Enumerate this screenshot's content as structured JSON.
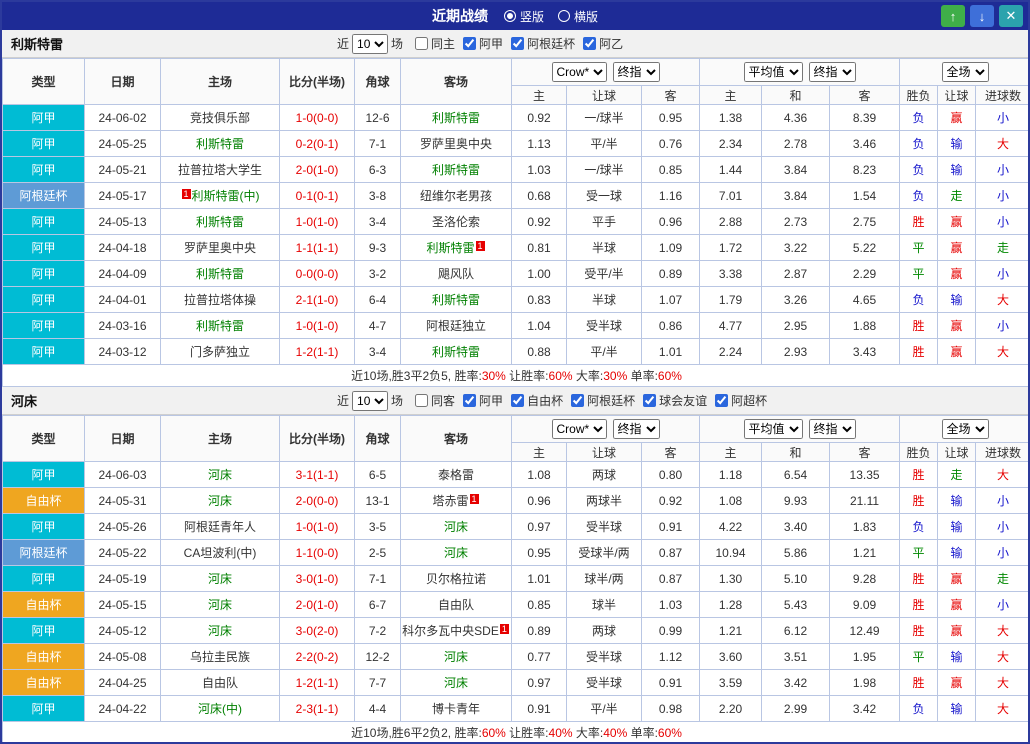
{
  "titlebar": {
    "title": "近期战绩",
    "orientation_options": [
      {
        "label": "竖版",
        "selected": true
      },
      {
        "label": "横版",
        "selected": false
      }
    ],
    "buttons": {
      "up": "↑",
      "down": "↓",
      "close": "✕"
    }
  },
  "injury_badge": "1",
  "colors": {
    "titlebar_bg": "#1e2b96",
    "type_badges": {
      "阿甲": "#00bcd4",
      "阿根廷杯": "#5e9bd6",
      "自由杯": "#efa620"
    },
    "result": {
      "胜": "#e60000",
      "赢": "#e60000",
      "大": "#e60000",
      "负": "#1414cc",
      "输": "#1414cc",
      "小": "#1414cc",
      "平": "#008800",
      "走": "#008800"
    },
    "team_highlight": "#008000",
    "score": "#e60000"
  },
  "table_headers": {
    "left_cols": [
      "类型",
      "日期",
      "主场",
      "比分(半场)",
      "角球",
      "客场"
    ],
    "groups": [
      {
        "selects": [
          "Crow*",
          "终指"
        ],
        "cols": [
          "主",
          "让球",
          "客"
        ]
      },
      {
        "selects": [
          "平均值",
          "终指"
        ],
        "cols": [
          "主",
          "和",
          "客"
        ]
      },
      {
        "selects": [
          "全场"
        ],
        "cols": [
          "胜负",
          "让球",
          "进球数"
        ]
      }
    ]
  },
  "sections": [
    {
      "team": "利斯特雷",
      "filter": {
        "near_label": "近",
        "count": "10",
        "count_suffix": "场",
        "same_option": {
          "label": "同主",
          "checked": false
        },
        "leagues": [
          {
            "label": "阿甲",
            "checked": true
          },
          {
            "label": "阿根廷杯",
            "checked": true
          },
          {
            "label": "阿乙",
            "checked": true
          }
        ]
      },
      "rows": [
        {
          "type": "阿甲",
          "date": "24-06-02",
          "home": {
            "text": "竞技俱乐部"
          },
          "score": "1-0(0-0)",
          "corner": "12-6",
          "away": {
            "text": "利斯特雷",
            "highlight": true
          },
          "odds1": [
            "0.92",
            "一/球半",
            "0.95"
          ],
          "odds2": [
            "1.38",
            "4.36",
            "8.39"
          ],
          "results": [
            "负",
            "赢",
            "小"
          ]
        },
        {
          "type": "阿甲",
          "date": "24-05-25",
          "home": {
            "text": "利斯特雷",
            "highlight": true
          },
          "score": "0-2(0-1)",
          "corner": "7-1",
          "away": {
            "text": "罗萨里奥中央"
          },
          "odds1": [
            "1.13",
            "平/半",
            "0.76"
          ],
          "odds2": [
            "2.34",
            "2.78",
            "3.46"
          ],
          "results": [
            "负",
            "输",
            "大"
          ]
        },
        {
          "type": "阿甲",
          "date": "24-05-21",
          "home": {
            "text": "拉普拉塔大学生"
          },
          "score": "2-0(1-0)",
          "corner": "6-3",
          "away": {
            "text": "利斯特雷",
            "highlight": true
          },
          "odds1": [
            "1.03",
            "一/球半",
            "0.85"
          ],
          "odds2": [
            "1.44",
            "3.84",
            "8.23"
          ],
          "results": [
            "负",
            "输",
            "小"
          ]
        },
        {
          "type": "阿根廷杯",
          "date": "24-05-17",
          "home": {
            "text": "利斯特雷(中)",
            "highlight": true,
            "badge": "before"
          },
          "score": "0-1(0-1)",
          "corner": "3-8",
          "away": {
            "text": "纽维尔老男孩"
          },
          "odds1": [
            "0.68",
            "受一球",
            "1.16"
          ],
          "odds2": [
            "7.01",
            "3.84",
            "1.54"
          ],
          "results": [
            "负",
            "走",
            "小"
          ]
        },
        {
          "type": "阿甲",
          "date": "24-05-13",
          "home": {
            "text": "利斯特雷",
            "highlight": true
          },
          "score": "1-0(1-0)",
          "corner": "3-4",
          "away": {
            "text": "圣洛伦索"
          },
          "odds1": [
            "0.92",
            "平手",
            "0.96"
          ],
          "odds2": [
            "2.88",
            "2.73",
            "2.75"
          ],
          "results": [
            "胜",
            "赢",
            "小"
          ]
        },
        {
          "type": "阿甲",
          "date": "24-04-18",
          "home": {
            "text": "罗萨里奥中央"
          },
          "score": "1-1(1-1)",
          "corner": "9-3",
          "away": {
            "text": "利斯特雷",
            "highlight": true,
            "badge": "after"
          },
          "odds1": [
            "0.81",
            "半球",
            "1.09"
          ],
          "odds2": [
            "1.72",
            "3.22",
            "5.22"
          ],
          "results": [
            "平",
            "赢",
            "走"
          ]
        },
        {
          "type": "阿甲",
          "date": "24-04-09",
          "home": {
            "text": "利斯特雷",
            "highlight": true
          },
          "score": "0-0(0-0)",
          "corner": "3-2",
          "away": {
            "text": "飓风队"
          },
          "odds1": [
            "1.00",
            "受平/半",
            "0.89"
          ],
          "odds2": [
            "3.38",
            "2.87",
            "2.29"
          ],
          "results": [
            "平",
            "赢",
            "小"
          ]
        },
        {
          "type": "阿甲",
          "date": "24-04-01",
          "home": {
            "text": "拉普拉塔体操"
          },
          "score": "2-1(1-0)",
          "corner": "6-4",
          "away": {
            "text": "利斯特雷",
            "highlight": true
          },
          "odds1": [
            "0.83",
            "半球",
            "1.07"
          ],
          "odds2": [
            "1.79",
            "3.26",
            "4.65"
          ],
          "results": [
            "负",
            "输",
            "大"
          ]
        },
        {
          "type": "阿甲",
          "date": "24-03-16",
          "home": {
            "text": "利斯特雷",
            "highlight": true
          },
          "score": "1-0(1-0)",
          "corner": "4-7",
          "away": {
            "text": "阿根廷独立"
          },
          "odds1": [
            "1.04",
            "受半球",
            "0.86"
          ],
          "odds2": [
            "4.77",
            "2.95",
            "1.88"
          ],
          "results": [
            "胜",
            "赢",
            "小"
          ]
        },
        {
          "type": "阿甲",
          "date": "24-03-12",
          "home": {
            "text": "门多萨独立"
          },
          "score": "1-2(1-1)",
          "corner": "3-4",
          "away": {
            "text": "利斯特雷",
            "highlight": true
          },
          "odds1": [
            "0.88",
            "平/半",
            "1.01"
          ],
          "odds2": [
            "2.24",
            "2.93",
            "3.43"
          ],
          "results": [
            "胜",
            "赢",
            "大"
          ]
        }
      ],
      "summary": [
        {
          "t": "近10场,胜3平2负5, 胜率:",
          "red": false
        },
        {
          "t": "30%",
          "red": true
        },
        {
          "t": " 让胜率:",
          "red": false
        },
        {
          "t": "60%",
          "red": true
        },
        {
          "t": " 大率:",
          "red": false
        },
        {
          "t": "30%",
          "red": true
        },
        {
          "t": " 单率:",
          "red": false
        },
        {
          "t": "60%",
          "red": true
        }
      ]
    },
    {
      "team": "河床",
      "filter": {
        "near_label": "近",
        "count": "10",
        "count_suffix": "场",
        "same_option": {
          "label": "同客",
          "checked": false
        },
        "leagues": [
          {
            "label": "阿甲",
            "checked": true
          },
          {
            "label": "自由杯",
            "checked": true
          },
          {
            "label": "阿根廷杯",
            "checked": true
          },
          {
            "label": "球会友谊",
            "checked": true
          },
          {
            "label": "阿超杯",
            "checked": true
          }
        ]
      },
      "rows": [
        {
          "type": "阿甲",
          "date": "24-06-03",
          "home": {
            "text": "河床",
            "highlight": true
          },
          "score": "3-1(1-1)",
          "corner": "6-5",
          "away": {
            "text": "泰格雷"
          },
          "odds1": [
            "1.08",
            "两球",
            "0.80"
          ],
          "odds2": [
            "1.18",
            "6.54",
            "13.35"
          ],
          "results": [
            "胜",
            "走",
            "大"
          ]
        },
        {
          "type": "自由杯",
          "date": "24-05-31",
          "home": {
            "text": "河床",
            "highlight": true
          },
          "score": "2-0(0-0)",
          "corner": "13-1",
          "away": {
            "text": "塔赤雷",
            "badge": "after"
          },
          "odds1": [
            "0.96",
            "两球半",
            "0.92"
          ],
          "odds2": [
            "1.08",
            "9.93",
            "21.11"
          ],
          "results": [
            "胜",
            "输",
            "小"
          ]
        },
        {
          "type": "阿甲",
          "date": "24-05-26",
          "home": {
            "text": "阿根廷青年人"
          },
          "score": "1-0(1-0)",
          "corner": "3-5",
          "away": {
            "text": "河床",
            "highlight": true
          },
          "odds1": [
            "0.97",
            "受半球",
            "0.91"
          ],
          "odds2": [
            "4.22",
            "3.40",
            "1.83"
          ],
          "results": [
            "负",
            "输",
            "小"
          ]
        },
        {
          "type": "阿根廷杯",
          "date": "24-05-22",
          "home": {
            "text": "CA坦波利(中)"
          },
          "score": "1-1(0-0)",
          "corner": "2-5",
          "away": {
            "text": "河床",
            "highlight": true
          },
          "odds1": [
            "0.95",
            "受球半/两",
            "0.87"
          ],
          "odds2": [
            "10.94",
            "5.86",
            "1.21"
          ],
          "results": [
            "平",
            "输",
            "小"
          ]
        },
        {
          "type": "阿甲",
          "date": "24-05-19",
          "home": {
            "text": "河床",
            "highlight": true
          },
          "score": "3-0(1-0)",
          "corner": "7-1",
          "away": {
            "text": "贝尔格拉诺"
          },
          "odds1": [
            "1.01",
            "球半/两",
            "0.87"
          ],
          "odds2": [
            "1.30",
            "5.10",
            "9.28"
          ],
          "results": [
            "胜",
            "赢",
            "走"
          ]
        },
        {
          "type": "自由杯",
          "date": "24-05-15",
          "home": {
            "text": "河床",
            "highlight": true
          },
          "score": "2-0(1-0)",
          "corner": "6-7",
          "away": {
            "text": "自由队"
          },
          "odds1": [
            "0.85",
            "球半",
            "1.03"
          ],
          "odds2": [
            "1.28",
            "5.43",
            "9.09"
          ],
          "results": [
            "胜",
            "赢",
            "小"
          ]
        },
        {
          "type": "阿甲",
          "date": "24-05-12",
          "home": {
            "text": "河床",
            "highlight": true
          },
          "score": "3-0(2-0)",
          "corner": "7-2",
          "away": {
            "text": "科尔多瓦中央SDE",
            "badge": "after"
          },
          "odds1": [
            "0.89",
            "两球",
            "0.99"
          ],
          "odds2": [
            "1.21",
            "6.12",
            "12.49"
          ],
          "results": [
            "胜",
            "赢",
            "大"
          ]
        },
        {
          "type": "自由杯",
          "date": "24-05-08",
          "home": {
            "text": "乌拉圭民族"
          },
          "score": "2-2(0-2)",
          "corner": "12-2",
          "away": {
            "text": "河床",
            "highlight": true
          },
          "odds1": [
            "0.77",
            "受半球",
            "1.12"
          ],
          "odds2": [
            "3.60",
            "3.51",
            "1.95"
          ],
          "results": [
            "平",
            "输",
            "大"
          ]
        },
        {
          "type": "自由杯",
          "date": "24-04-25",
          "home": {
            "text": "自由队"
          },
          "score": "1-2(1-1)",
          "corner": "7-7",
          "away": {
            "text": "河床",
            "highlight": true
          },
          "odds1": [
            "0.97",
            "受半球",
            "0.91"
          ],
          "odds2": [
            "3.59",
            "3.42",
            "1.98"
          ],
          "results": [
            "胜",
            "赢",
            "大"
          ]
        },
        {
          "type": "阿甲",
          "date": "24-04-22",
          "home": {
            "text": "河床(中)",
            "highlight": true
          },
          "score": "2-3(1-1)",
          "corner": "4-4",
          "away": {
            "text": "博卡青年"
          },
          "odds1": [
            "0.91",
            "平/半",
            "0.98"
          ],
          "odds2": [
            "2.20",
            "2.99",
            "3.42"
          ],
          "results": [
            "负",
            "输",
            "大"
          ]
        }
      ],
      "summary": [
        {
          "t": "近10场,胜6平2负2, 胜率:",
          "red": false
        },
        {
          "t": "60%",
          "red": true
        },
        {
          "t": " 让胜率:",
          "red": false
        },
        {
          "t": "40%",
          "red": true
        },
        {
          "t": " 大率:",
          "red": false
        },
        {
          "t": "40%",
          "red": true
        },
        {
          "t": " 单率:",
          "red": false
        },
        {
          "t": "60%",
          "red": true
        }
      ]
    }
  ]
}
